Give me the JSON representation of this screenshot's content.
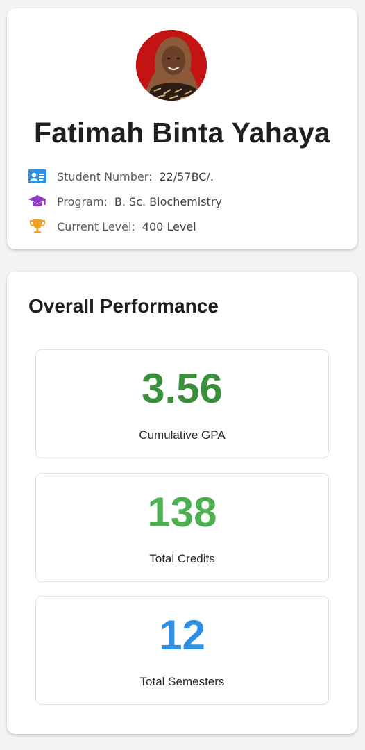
{
  "profile": {
    "name": "Fatimah Binta Yahaya",
    "avatar_alt": "profile-photo",
    "info": [
      {
        "icon": "id-card-icon",
        "label": "Student Number:",
        "value": "22/57BC/."
      },
      {
        "icon": "graduation-cap-icon",
        "label": "Program:",
        "value": "B. Sc. Biochemistry"
      },
      {
        "icon": "trophy-icon",
        "label": "Current Level:",
        "value": "400 Level"
      }
    ]
  },
  "performance": {
    "title": "Overall Performance",
    "stats": [
      {
        "value": "3.56",
        "label": "Cumulative GPA",
        "color": "#3a8f3a"
      },
      {
        "value": "138",
        "label": "Total Credits",
        "color": "#4caf50"
      },
      {
        "value": "12",
        "label": "Total Semesters",
        "color": "#2f8fe3"
      }
    ]
  },
  "colors": {
    "id_icon": "#2f8fe3",
    "program_icon": "#8e3bbf",
    "trophy_icon": "#f0a020"
  }
}
